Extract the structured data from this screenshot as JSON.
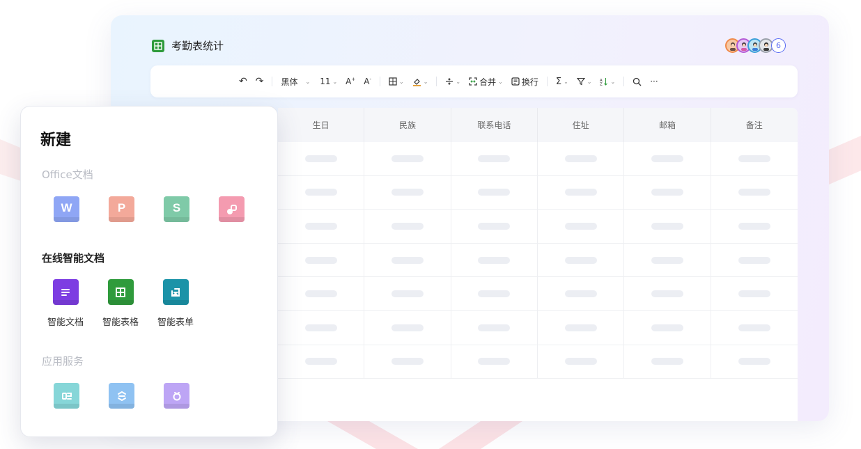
{
  "document": {
    "name": "考勤表统计",
    "collaborator_count": "6"
  },
  "toolbar": {
    "undo": "↶",
    "redo": "↷",
    "font": "黑体",
    "font_size": "11",
    "merge_label": "合并",
    "wrap_label": "换行",
    "more": "···"
  },
  "table": {
    "columns": [
      "生日",
      "民族",
      "联系电话",
      "住址",
      "邮箱",
      "备注"
    ],
    "placeholder_rows": 7
  },
  "new_panel": {
    "title": "新建",
    "office_section": "Office文档",
    "office_apps": [
      {
        "letter": "W",
        "color": "#8fa6f5"
      },
      {
        "letter": "P",
        "color": "#f3a99a"
      },
      {
        "letter": "S",
        "color": "#7fcaa8"
      },
      {
        "letter": "",
        "color": "#f49bb0"
      }
    ],
    "smart_section": "在线智能文档",
    "smart_apps": [
      {
        "label": "智能文档",
        "color": "#7d3de2"
      },
      {
        "label": "智能表格",
        "color": "#2f9b3c"
      },
      {
        "label": "智能表单",
        "color": "#1b93a8"
      }
    ],
    "services_section": "应用服务",
    "service_apps": [
      {
        "color": "#86d6d8"
      },
      {
        "color": "#8fc2f2"
      },
      {
        "color": "#bda5f5"
      }
    ]
  },
  "colors": {
    "accent": "#5a6cf3",
    "sheet_green": "#2f9b3c"
  }
}
